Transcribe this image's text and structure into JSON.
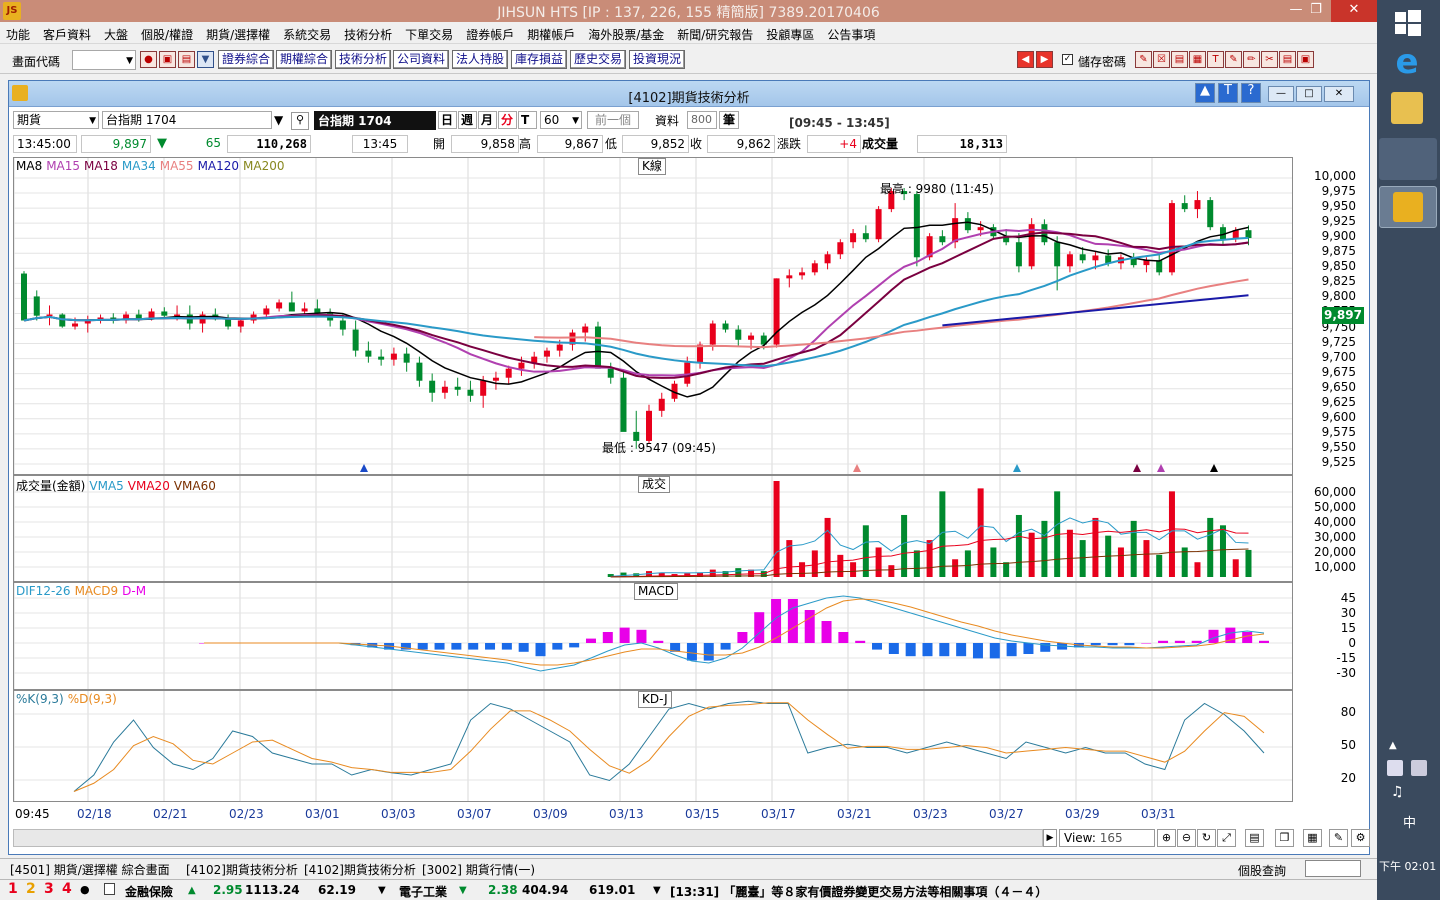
{
  "app": {
    "title": "JIHSUN HTS      [IP : 137, 226, 155 精簡版] 7389.20170406",
    "logo": "JS"
  },
  "menu": [
    "功能",
    "客戶資料",
    "大盤",
    "個股/權證",
    "期貨/選擇權",
    "系統交易",
    "技術分析",
    "下單交易",
    "證券帳戶",
    "期權帳戶",
    "海外股票/基金",
    "新聞/研究報告",
    "投顧專區",
    "公告事項"
  ],
  "toolbar": {
    "code_label": "畫面代碼",
    "buttons": [
      "證券綜合",
      "期權綜合",
      "技術分析",
      "公司資料",
      "法人持股",
      "庫存損益",
      "歷史交易",
      "投資現況"
    ],
    "save_password": "儲存密碼"
  },
  "child": {
    "title": "[4102]期貨技術分析"
  },
  "controls": {
    "type": "期貨",
    "symbol": "台指期 1704",
    "symbol_name": "台指期 1704",
    "period_buttons": [
      "日",
      "週",
      "月",
      "分",
      "T"
    ],
    "active_period": "分",
    "interval": "60",
    "prev": "前一個",
    "data_label": "資料",
    "data_count": "800",
    "unit": "筆",
    "range": "[09:45 - 13:45]"
  },
  "quote": {
    "time": "13:45:00",
    "price": "9,897",
    "change": "65",
    "volume_total": "110,268",
    "bar_time": "13:45",
    "open_label": "開",
    "open": "9,858",
    "high_label": "高",
    "high": "9,867",
    "low_label": "低",
    "low": "9,852",
    "close_label": "收",
    "close": "9,862",
    "chg_label": "漲跌",
    "chg": "+4",
    "vol_label": "成交量",
    "vol": "18,313"
  },
  "panels": {
    "kline": {
      "label": "K線",
      "legend": [
        "MA8",
        "MA15",
        "MA18",
        "MA34",
        "MA55",
        "MA120",
        "MA200"
      ],
      "high_note": "最高 : 9980 (11:45)",
      "low_note": "最低 : 9547 (09:45)",
      "yaxis": [
        "10,000",
        "9,975",
        "9,950",
        "9,925",
        "9,900",
        "9,875",
        "9,850",
        "9,825",
        "9,800",
        "9,775",
        "9,750",
        "9,725",
        "9,700",
        "9,675",
        "9,650",
        "9,625",
        "9,600",
        "9,575",
        "9,550",
        "9,525"
      ],
      "last_price": "9,897"
    },
    "volume": {
      "label": "成交",
      "legend": [
        "成交量(金額)",
        "VMA5",
        "VMA20",
        "VMA60"
      ],
      "yaxis": [
        "60,000",
        "50,000",
        "40,000",
        "30,000",
        "20,000",
        "10,000"
      ]
    },
    "macd": {
      "label": "MACD",
      "legend": [
        "DIF12-26",
        "MACD9",
        "D-M"
      ],
      "yaxis": [
        "45",
        "30",
        "15",
        "0",
        "-15",
        "-30"
      ]
    },
    "kd": {
      "label": "KD-J",
      "legend": [
        "%K(9,3)",
        "%D(9,3)"
      ],
      "yaxis": [
        "80",
        "50",
        "20"
      ]
    }
  },
  "xaxis": [
    "09:45",
    "02/18",
    "02/21",
    "02/23",
    "03/01",
    "03/03",
    "03/07",
    "03/09",
    "03/13",
    "03/15",
    "03/17",
    "03/21",
    "03/23",
    "03/27",
    "03/29",
    "03/31"
  ],
  "view": {
    "label": "View:",
    "value": "165"
  },
  "tabs": [
    "[4501] 期貨/選擇權 綜合畫面",
    "[4102]期貨技術分析",
    "[4102]期貨技術分析",
    "[3002] 期貨行情(一)"
  ],
  "tabs_right": "個股查詢",
  "status": {
    "nums": [
      "1",
      "2",
      "3",
      "4"
    ],
    "item1": "金融保險",
    "item1_chg": "2.95",
    "item1_val": "1113.24",
    "item1_v2": "62.19",
    "item2": "電子工業",
    "item2_chg": "2.38",
    "item2_val": "404.94",
    "item2_v2": "619.01",
    "news": "[13:31] 「麗臺」等８家有價證券變更交易方法等相關事項（４－４）"
  },
  "taskbar": {
    "time": "下午 02:01",
    "ime": "中"
  },
  "colors": {
    "up": "#e8001c",
    "down": "#008a2e",
    "bg": "#ffffff"
  },
  "chart_data": {
    "type": "candlestick",
    "yrange": [
      9525,
      10000
    ],
    "candles": [
      [
        9838,
        9842,
        9800,
        9760
      ],
      [
        9800,
        9810,
        9760,
        9768
      ],
      [
        9768,
        9785,
        9752,
        9770
      ],
      [
        9770,
        9772,
        9748,
        9750
      ],
      [
        9750,
        9765,
        9745,
        9755
      ],
      [
        9755,
        9768,
        9740,
        9760
      ],
      [
        9760,
        9770,
        9755,
        9765
      ],
      [
        9765,
        9772,
        9755,
        9760
      ],
      [
        9760,
        9775,
        9755,
        9770
      ],
      [
        9770,
        9778,
        9758,
        9763
      ],
      [
        9763,
        9780,
        9760,
        9775
      ],
      [
        9775,
        9782,
        9765,
        9768
      ],
      [
        9768,
        9785,
        9760,
        9770
      ],
      [
        9770,
        9785,
        9745,
        9755
      ],
      [
        9755,
        9775,
        9740,
        9770
      ],
      [
        9770,
        9780,
        9760,
        9762
      ],
      [
        9762,
        9770,
        9745,
        9750
      ],
      [
        9750,
        9765,
        9740,
        9760
      ],
      [
        9760,
        9775,
        9755,
        9770
      ],
      [
        9770,
        9785,
        9765,
        9780
      ],
      [
        9780,
        9795,
        9775,
        9790
      ],
      [
        9790,
        9808,
        9780,
        9775
      ],
      [
        9775,
        9790,
        9765,
        9780
      ],
      [
        9780,
        9795,
        9768,
        9772
      ],
      [
        9772,
        9780,
        9750,
        9760
      ],
      [
        9760,
        9770,
        9735,
        9745
      ],
      [
        9745,
        9760,
        9700,
        9710
      ],
      [
        9710,
        9725,
        9690,
        9700
      ],
      [
        9700,
        9712,
        9685,
        9695
      ],
      [
        9695,
        9715,
        9685,
        9705
      ],
      [
        9705,
        9715,
        9675,
        9690
      ],
      [
        9690,
        9700,
        9650,
        9660
      ],
      [
        9660,
        9672,
        9625,
        9640
      ],
      [
        9640,
        9660,
        9630,
        9650
      ],
      [
        9650,
        9665,
        9635,
        9645
      ],
      [
        9645,
        9660,
        9625,
        9635
      ],
      [
        9635,
        9668,
        9615,
        9660
      ],
      [
        9660,
        9675,
        9645,
        9665
      ],
      [
        9665,
        9685,
        9655,
        9680
      ],
      [
        9680,
        9700,
        9668,
        9690
      ],
      [
        9690,
        9708,
        9680,
        9700
      ],
      [
        9700,
        9715,
        9690,
        9710
      ],
      [
        9710,
        9728,
        9700,
        9720
      ],
      [
        9720,
        9745,
        9710,
        9740
      ],
      [
        9740,
        9755,
        9725,
        9750
      ],
      [
        9750,
        9758,
        9690,
        9680
      ],
      [
        9680,
        9690,
        9655,
        9665
      ],
      [
        9665,
        9675,
        9600,
        9575
      ],
      [
        9575,
        9610,
        9547,
        9560
      ],
      [
        9560,
        9620,
        9555,
        9610
      ],
      [
        9610,
        9640,
        9600,
        9630
      ],
      [
        9630,
        9660,
        9625,
        9655
      ],
      [
        9655,
        9700,
        9650,
        9690
      ],
      [
        9690,
        9725,
        9680,
        9720
      ],
      [
        9720,
        9760,
        9710,
        9755
      ],
      [
        9755,
        9760,
        9740,
        9745
      ],
      [
        9745,
        9752,
        9718,
        9728
      ],
      [
        9728,
        9740,
        9712,
        9735
      ],
      [
        9735,
        9740,
        9712,
        9720
      ],
      [
        9720,
        9830,
        9715,
        9830
      ],
      [
        9830,
        9845,
        9815,
        9835
      ],
      [
        9835,
        9848,
        9828,
        9840
      ],
      [
        9840,
        9860,
        9835,
        9855
      ],
      [
        9855,
        9875,
        9845,
        9870
      ],
      [
        9870,
        9895,
        9862,
        9890
      ],
      [
        9890,
        9912,
        9880,
        9905
      ],
      [
        9905,
        9918,
        9890,
        9895
      ],
      [
        9895,
        9950,
        9890,
        9945
      ],
      [
        9945,
        9980,
        9940,
        9975
      ],
      [
        9975,
        9980,
        9960,
        9970
      ],
      [
        9970,
        9975,
        9850,
        9865
      ],
      [
        9865,
        9905,
        9860,
        9900
      ],
      [
        9900,
        9910,
        9885,
        9890
      ],
      [
        9890,
        9955,
        9880,
        9930
      ],
      [
        9930,
        9940,
        9905,
        9910
      ],
      [
        9910,
        9925,
        9900,
        9915
      ],
      [
        9915,
        9920,
        9895,
        9900
      ],
      [
        9900,
        9912,
        9885,
        9890
      ],
      [
        9890,
        9905,
        9840,
        9850
      ],
      [
        9850,
        9930,
        9845,
        9920
      ],
      [
        9920,
        9928,
        9885,
        9890
      ],
      [
        9890,
        9900,
        9810,
        9850
      ],
      [
        9850,
        9875,
        9840,
        9870
      ],
      [
        9870,
        9882,
        9855,
        9860
      ],
      [
        9860,
        9875,
        9845,
        9868
      ],
      [
        9868,
        9878,
        9850,
        9855
      ],
      [
        9855,
        9870,
        9845,
        9865
      ],
      [
        9865,
        9872,
        9848,
        9852
      ],
      [
        9852,
        9865,
        9840,
        9860
      ],
      [
        9860,
        9870,
        9835,
        9840
      ],
      [
        9840,
        9960,
        9835,
        9955
      ],
      [
        9955,
        9968,
        9940,
        9945
      ],
      [
        9945,
        9975,
        9930,
        9960
      ],
      [
        9960,
        9965,
        9910,
        9915
      ],
      [
        9915,
        9920,
        9885,
        9895
      ],
      [
        9895,
        9915,
        9890,
        9910
      ],
      [
        9910,
        9918,
        9885,
        9897
      ]
    ],
    "volume": [
      0,
      0,
      0,
      0,
      0,
      0,
      0,
      0,
      0,
      0,
      0,
      0,
      0,
      0,
      0,
      0,
      0,
      0,
      0,
      0,
      0,
      0,
      0,
      0,
      0,
      0,
      0,
      0,
      0,
      0,
      0,
      0,
      0,
      0,
      0,
      0,
      0,
      0,
      0,
      0,
      0,
      0,
      0,
      0,
      0,
      0,
      2000,
      3000,
      2500,
      4000,
      3000,
      2000,
      2500,
      3000,
      5000,
      4000,
      6000,
      5000,
      4000,
      65000,
      25000,
      10000,
      18000,
      40000,
      15000,
      10000,
      35000,
      20000,
      8000,
      42000,
      18000,
      25000,
      58000,
      12000,
      18000,
      60000,
      20000,
      10000,
      42000,
      30000,
      38000,
      58000,
      32000,
      25000,
      40000,
      28000,
      20000,
      38000,
      25000,
      15000,
      58000,
      20000,
      10000,
      40000,
      35000,
      12000,
      18313
    ],
    "macd_dif": [
      0,
      0,
      0,
      0,
      0,
      0,
      0,
      0,
      0,
      -2,
      -4,
      -6,
      -8,
      -10,
      -12,
      -14,
      -16,
      -18,
      -20,
      -24,
      -28,
      -25,
      -22,
      -15,
      -8,
      -2,
      0,
      -5,
      -12,
      -18,
      -20,
      -15,
      -5,
      10,
      25,
      35,
      40,
      45,
      47,
      45,
      40,
      35,
      30,
      25,
      20,
      15,
      10,
      5,
      2,
      0,
      -2,
      -3,
      -4,
      -4,
      -5,
      -5,
      -5,
      -4,
      -3,
      -2,
      5,
      10,
      12,
      10
    ],
    "macd_sig": [
      0,
      0,
      0,
      0,
      0,
      0,
      0,
      0,
      0,
      -1,
      -2,
      -3,
      -5,
      -7,
      -9,
      -11,
      -13,
      -15,
      -17,
      -20,
      -22,
      -22,
      -20,
      -17,
      -13,
      -9,
      -6,
      -6,
      -8,
      -10,
      -12,
      -12,
      -10,
      -4,
      5,
      15,
      25,
      35,
      42,
      44,
      43,
      40,
      36,
      31,
      26,
      21,
      17,
      12,
      8,
      5,
      2,
      0,
      -2,
      -3,
      -4,
      -4,
      -5,
      -5,
      -4,
      -3,
      -1,
      3,
      7,
      9
    ]
  }
}
